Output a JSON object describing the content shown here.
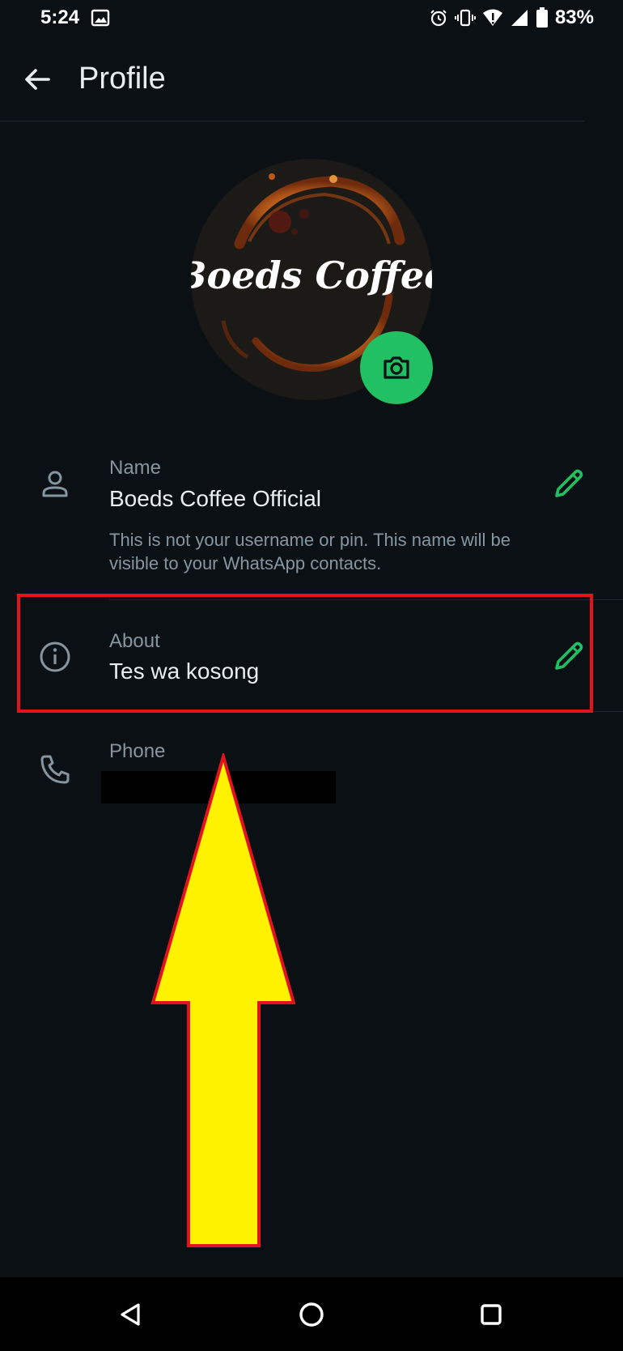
{
  "status_bar": {
    "time": "5:24",
    "battery": "83%",
    "icons": [
      "gallery-icon",
      "alarm-icon",
      "vibrate-icon",
      "wifi-icon",
      "signal-icon",
      "battery-icon"
    ]
  },
  "app_bar": {
    "title": "Profile",
    "back_icon": "arrow-left-icon"
  },
  "avatar": {
    "text": "Boeds Coffee",
    "camera_icon": "camera-icon"
  },
  "profile": {
    "name": {
      "label": "Name",
      "value": "Boeds Coffee Official",
      "hint": "This is not your username or pin. This name will be visible to your WhatsApp contacts.",
      "icon": "person-icon",
      "edit_icon": "pencil-icon"
    },
    "about": {
      "label": "About",
      "value": "Tes wa kosong",
      "icon": "info-icon",
      "edit_icon": "pencil-icon"
    },
    "phone": {
      "label": "Phone",
      "icon": "phone-icon"
    }
  },
  "nav_bar": {
    "buttons": [
      "back-triangle-icon",
      "home-circle-icon",
      "recents-square-icon"
    ]
  },
  "colors": {
    "background": "#0b1014",
    "accent_green": "#21c063",
    "annotation_red": "#e3121d",
    "annotation_yellow": "#fff200"
  }
}
